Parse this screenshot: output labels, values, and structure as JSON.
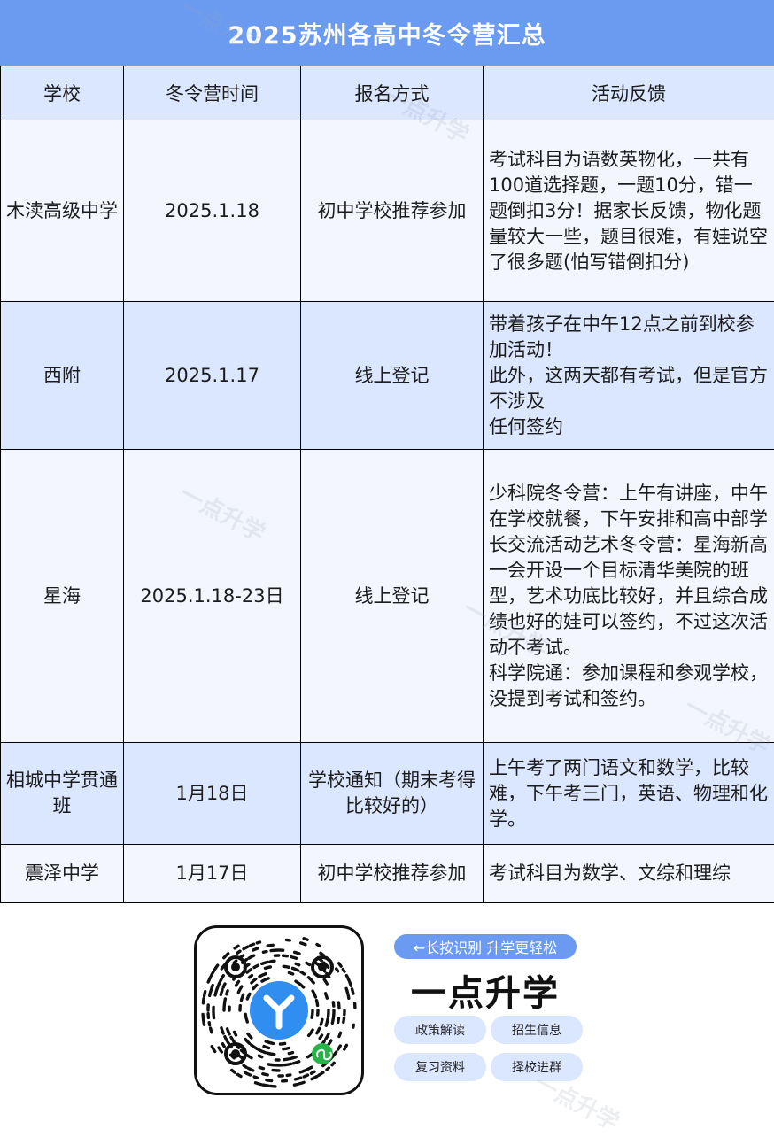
{
  "title": "2025苏州各高中冬令营汇总",
  "columns": [
    "学校",
    "冬令营时间",
    "报名方式",
    "活动反馈"
  ],
  "rows": [
    {
      "school": "木渎高级中学",
      "date": "2025.1.18",
      "signup": "初中学校推荐参加",
      "feedback": [
        "考试科目为语数英物化，一共有100道选择题，一题10分，错一题倒扣3分！据家长反馈，物化题量较大一些，题目很难，有娃说空了很多题(怕写错倒扣分)"
      ]
    },
    {
      "school": "西附",
      "date": "2025.1.17",
      "signup": "线上登记",
      "feedback": [
        "带着孩子在中午12点之前到校参加活动！",
        "此外，这两天都有考试，但是官方不涉及",
        "任何签约"
      ]
    },
    {
      "school": "星海",
      "date": "2025.1.18-23日",
      "signup": "线上登记",
      "feedback": [
        "少科院冬令营：上午有讲座，中午在学校就餐，下午安排和高中部学长交流活动艺术冬令营：星海新高一会开设一个目标清华美院的班型，艺术功底比较好，并且综合成绩也好的娃可以签约，不过这次活",
        "动不考试。",
        "科学院通：参加课程和参观学校，没提到考试和签约。"
      ]
    },
    {
      "school": "相城中学贯通班",
      "date": "1月18日",
      "signup": "学校通知（期末考得比较好的）",
      "feedback": [
        "上午考了两门语文和数学，比较难，下午考三门，英语、物理和化学。"
      ]
    },
    {
      "school": "震泽中学",
      "date": "1月17日",
      "signup": "初中学校推荐参加",
      "feedback": [
        "考试科目为数学、文综和理综"
      ]
    }
  ],
  "footer": {
    "hint": "←长按识别 升学更轻松",
    "brand": "一点升学",
    "tags": [
      "政策解读",
      "招生信息",
      "复习资料",
      "择校进群"
    ],
    "watermark": "一点升学"
  },
  "colors": {
    "title_bg": "#6b9bf1",
    "row_light": "#f3f6ff",
    "row_dark": "#dbe6ff",
    "qr_center": "#2f8ef0",
    "wechat_badge": "#2ab24a"
  }
}
